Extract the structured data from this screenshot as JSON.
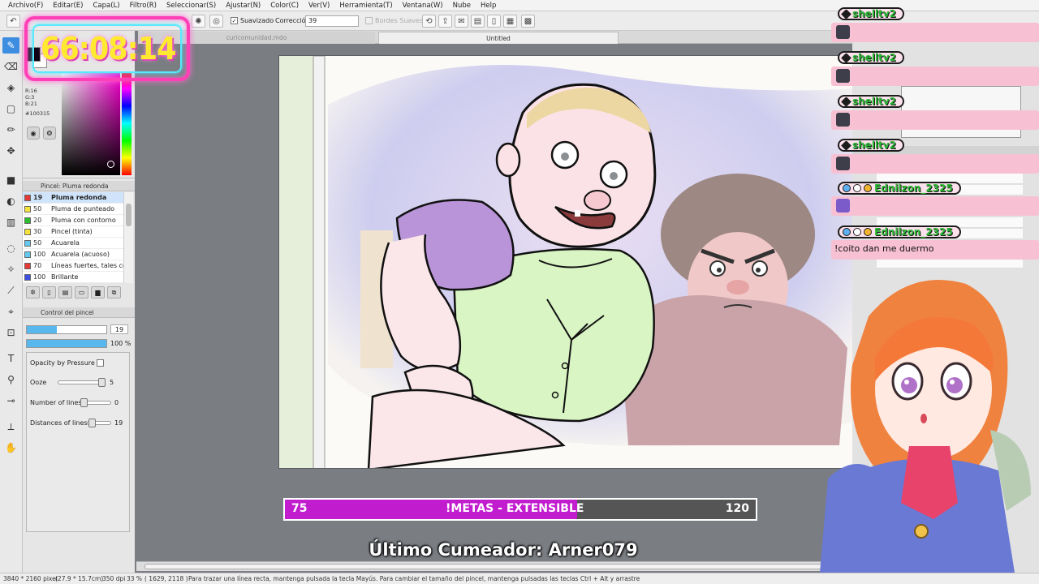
{
  "menu": [
    "Archivo(F)",
    "Editar(E)",
    "Capa(L)",
    "Filtro(R)",
    "Seleccionar(S)",
    "Ajustar(N)",
    "Color(C)",
    "Ver(V)",
    "Herramienta(T)",
    "Ventana(W)",
    "Nube",
    "Help"
  ],
  "tool_options": {
    "smoothing_label": "Suavizado",
    "correction_label": "Corrección",
    "correction_value": "39",
    "soft_edges_label": "Bordes Suaves"
  },
  "doc_tabs": {
    "inactive": "curicomunidad.mdo",
    "active": "Untitled"
  },
  "color": {
    "r": "R:16",
    "g": "G:3",
    "b": "B:21",
    "hex": "#100315"
  },
  "brush_panel": {
    "title": "Pincel: Pluma redonda",
    "items": [
      {
        "size": "19",
        "name": "Pluma redonda",
        "color": "#e53935"
      },
      {
        "size": "50",
        "name": "Pluma de punteado",
        "color": "#f5e23a"
      },
      {
        "size": "20",
        "name": "Pluma con contorno",
        "color": "#2bbd2b"
      },
      {
        "size": "30",
        "name": "Pincel (tinta)",
        "color": "#f5e23a"
      },
      {
        "size": "50",
        "name": "Acuarela",
        "color": "#63c8f2"
      },
      {
        "size": "100",
        "name": "Acuarela (acuoso)",
        "color": "#63c8f2"
      },
      {
        "size": "70",
        "name": "Líneas fuertes, tales con",
        "color": "#e53935"
      },
      {
        "size": "100",
        "name": "Brillante",
        "color": "#3d4ee0"
      }
    ]
  },
  "brush_control": {
    "title": "Control del pincel",
    "size_value": "19",
    "size_fraction": 0.38,
    "opacity_value": "100 %",
    "opacity_fraction": 1.0,
    "opacity_by_pressure": "Opacity by Pressure",
    "ooze_label": "Ooze",
    "ooze_value": "5",
    "lines_label": "Number of lines",
    "lines_value": "0",
    "distance_label": "Distances of lines",
    "distance_value": "19"
  },
  "timer": "66:08:14",
  "goal": {
    "left": "75",
    "label": "!METAS - EXTENSIBLE",
    "right": "120",
    "progress_fraction": 0.62
  },
  "last_cum": "Último Cumeador: Arner079",
  "chat": [
    {
      "user": "shelltv2",
      "message": ""
    },
    {
      "user": "shelltv2",
      "message": ""
    },
    {
      "user": "shelltv2",
      "message": ""
    },
    {
      "user": "shelltv2",
      "message": ""
    },
    {
      "user": "Ednilzon_2325",
      "message": ""
    },
    {
      "user": "Ednilzon_2325",
      "message": "!coito dan me duermo"
    }
  ],
  "status": {
    "dimensions": "3840 * 2160 pixel",
    "size_cm": "(27.9 * 15.7cm)",
    "dpi": "350 dpi",
    "zoom": "33 %",
    "coords": "( 1629, 2118 )",
    "hint": "Para trazar una línea recta, mantenga pulsada la tecla Mayús. Para cambiar el tamaño del pincel, mantenga pulsadas las teclas Ctrl + Alt y arrastre"
  },
  "colors": {
    "accent": "#3d8de0",
    "goal_fill": "#c21ccf",
    "timer_text": "#ffea2f",
    "chat_name": "#2dba37"
  }
}
